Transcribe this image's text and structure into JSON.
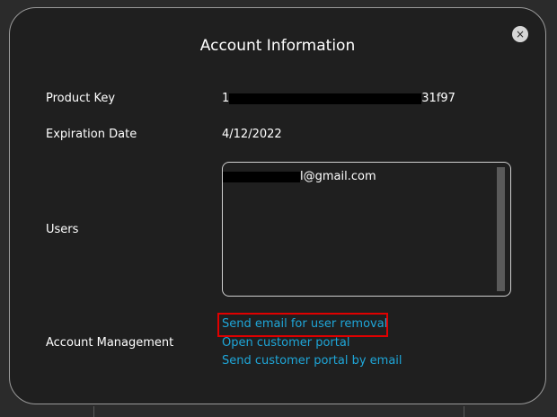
{
  "dialog": {
    "title": "Account Information",
    "close_label": "×"
  },
  "fields": {
    "product_key_label": "Product Key",
    "product_key_prefix": "1",
    "product_key_suffix": "31f97",
    "expiration_label": "Expiration Date",
    "expiration_value": "4/12/2022",
    "users_label": "Users",
    "user_email_suffix": "l@gmail.com",
    "account_management_label": "Account Management"
  },
  "links": {
    "send_removal": "Send email for user removal",
    "open_portal": "Open customer portal",
    "send_portal": "Send customer portal by email"
  },
  "colors": {
    "link": "#1fa6d8",
    "highlight": "#e00000",
    "background": "#1f1f1f"
  }
}
